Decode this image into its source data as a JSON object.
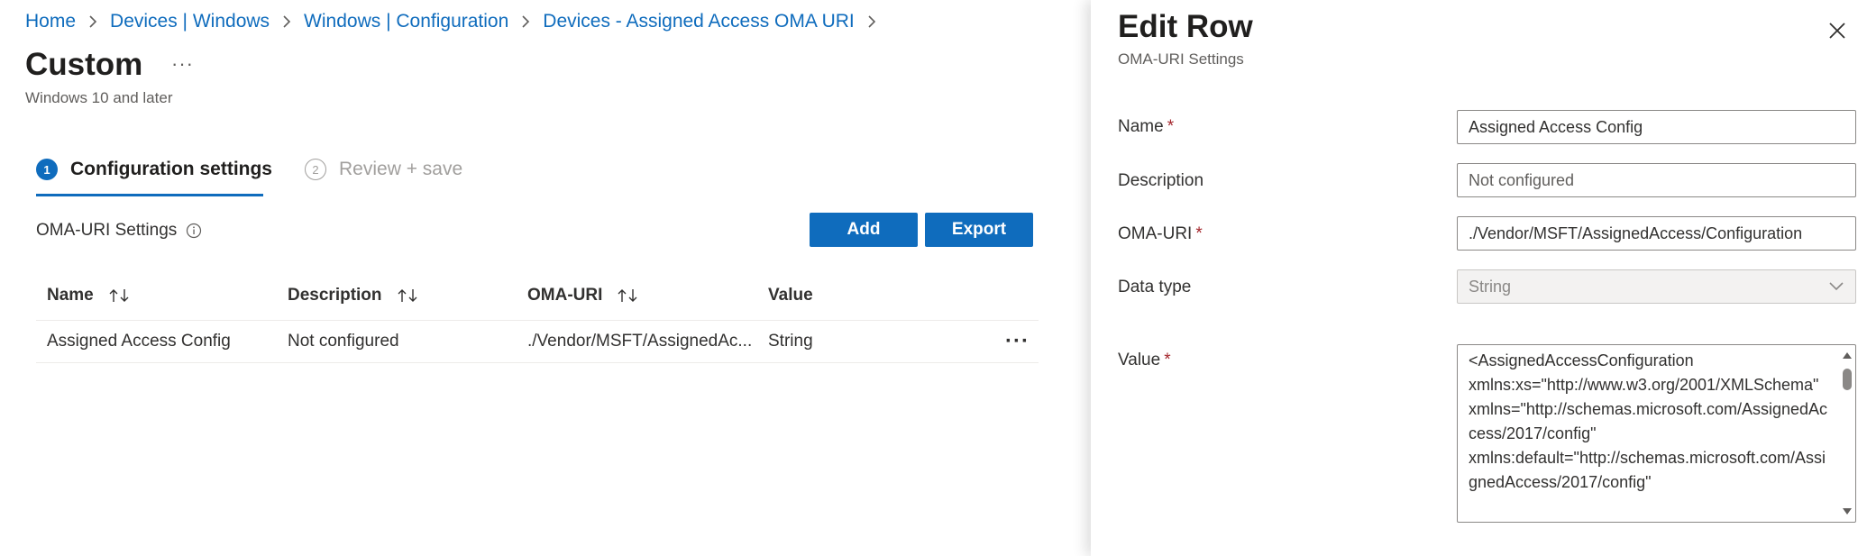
{
  "breadcrumb": [
    {
      "label": "Home"
    },
    {
      "label": "Devices | Windows"
    },
    {
      "label": "Windows | Configuration"
    },
    {
      "label": "Devices - Assigned Access OMA URI"
    }
  ],
  "page": {
    "title": "Custom",
    "more": "···",
    "subtitle": "Windows 10 and later"
  },
  "steps": [
    {
      "number": "1",
      "label": "Configuration settings",
      "state": "active"
    },
    {
      "number": "2",
      "label": "Review + save",
      "state": "inactive"
    }
  ],
  "section": {
    "label": "OMA-URI Settings",
    "add_label": "Add",
    "export_label": "Export"
  },
  "table": {
    "columns": [
      "Name",
      "Description",
      "OMA-URI",
      "Value"
    ],
    "rows": [
      {
        "name": "Assigned Access Config",
        "description": "Not configured",
        "oma_uri": "./Vendor/MSFT/AssignedAc...",
        "value": "String",
        "more": "···"
      }
    ]
  },
  "panel": {
    "title": "Edit Row",
    "subtitle": "OMA-URI Settings",
    "required_marker": "*",
    "fields": {
      "name": {
        "label": "Name",
        "value": "Assigned Access Config"
      },
      "description": {
        "label": "Description",
        "placeholder": "Not configured"
      },
      "oma_uri": {
        "label": "OMA-URI",
        "value": "./Vendor/MSFT/AssignedAccess/Configuration"
      },
      "data_type": {
        "label": "Data type",
        "value": "String"
      },
      "value": {
        "label": "Value",
        "text": "<AssignedAccessConfiguration\nxmlns:xs=\"http://www.w3.org/2001/XMLSchema\"\nxmlns=\"http://schemas.microsoft.com/AssignedAccess/2017/config\"\nxmlns:default=\"http://schemas.microsoft.com/AssignedAccess/2017/config\""
      }
    }
  },
  "colors": {
    "accent": "#0f6cbd",
    "required": "#a4262c",
    "text": "#323130",
    "muted": "#605e5c"
  },
  "icons": [
    "chevron-right-icon",
    "info-icon",
    "sort-icon",
    "close-icon",
    "chevron-down-icon",
    "more-icon"
  ]
}
